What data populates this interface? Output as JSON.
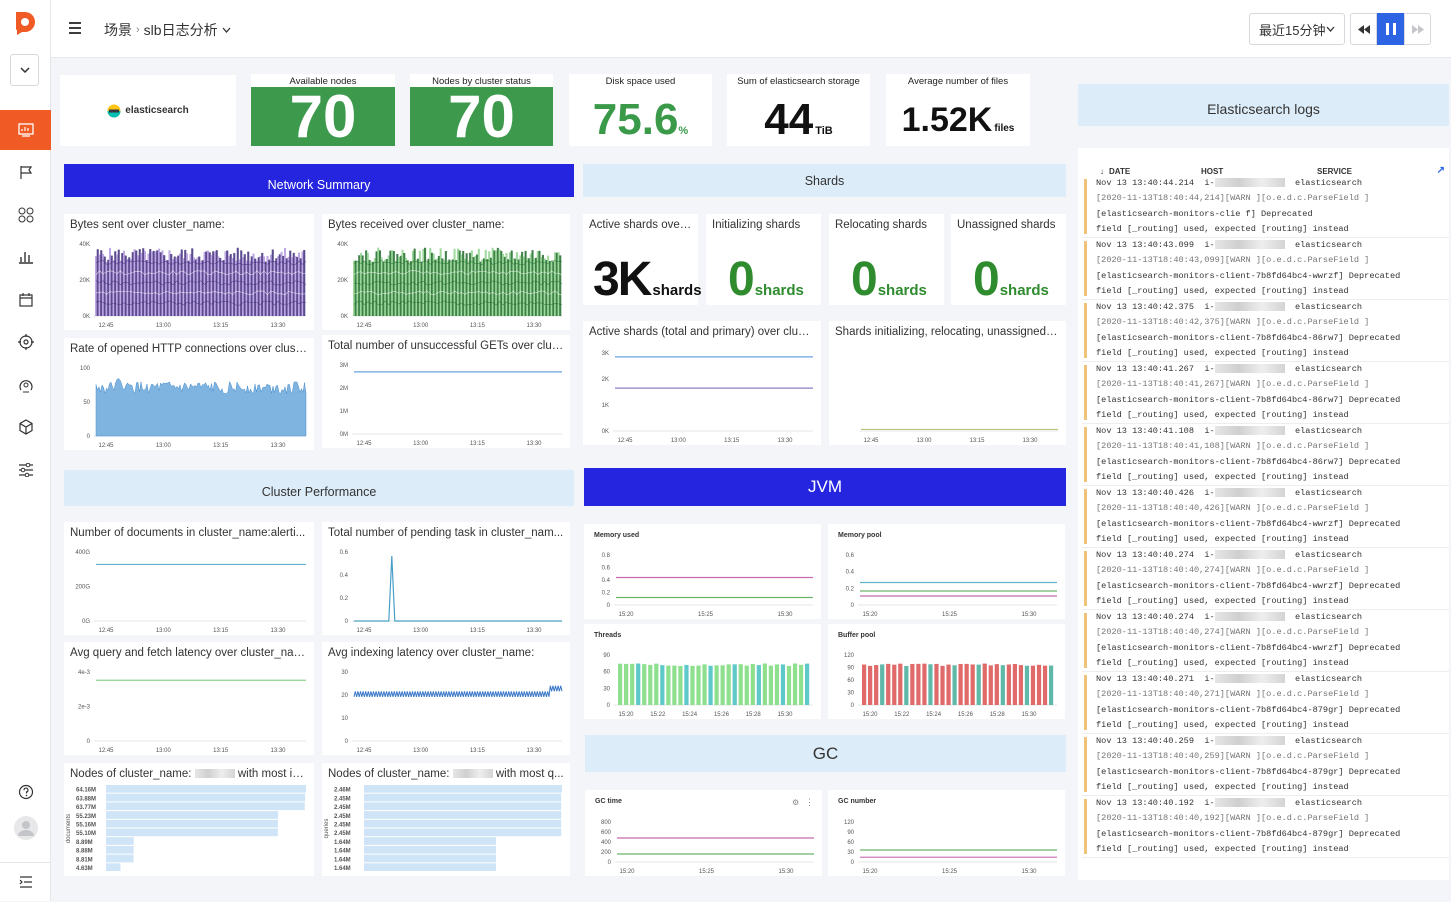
{
  "breadcrumb": {
    "root": "场景",
    "current": "slb日志分析"
  },
  "time_range": {
    "selected": "最近15分钟"
  },
  "stats": [
    {
      "label": "Available nodes",
      "value": "70"
    },
    {
      "label": "Nodes by cluster status",
      "value": "70"
    },
    {
      "label": "Disk space used",
      "value": "75.6",
      "unit": "%"
    },
    {
      "label": "Sum of elasticsearch storage",
      "value": "44",
      "unit": "TiB"
    },
    {
      "label": "Average number of files",
      "value": "1.52K",
      "unit": "files"
    }
  ],
  "logo_text": "elasticsearch",
  "sections": {
    "network": "Network Summary",
    "shards": "Shards",
    "cluster": "Cluster Performance",
    "jvm": "JVM",
    "gc": "GC",
    "logs": "Elasticsearch logs"
  },
  "panels": {
    "bytes_sent": "Bytes sent over cluster_name:",
    "bytes_received": "Bytes received over cluster_name:",
    "http_rate": "Rate of opened HTTP connections over cluste...",
    "unsucc_gets": "Total number of unsuccessful GETs over clust...",
    "docs": "Number of documents in cluster_name:alerti...",
    "pending": "Total number of pending task in cluster_nam...",
    "query_latency": "Avg query and fetch latency over cluster_nam...",
    "index_latency": "Avg indexing latency over cluster_name:",
    "nodes_docs": "Nodes of cluster_name:",
    "nodes_docs_suffix": "with most in...",
    "nodes_queries": "Nodes of cluster_name:",
    "nodes_queries_suffix": "with most q...",
    "active_shards_over": "Active shards (total and primary) over cluster...",
    "shards_init_reloc": "Shards initializing, relocating, unassigned ove..."
  },
  "shard_stats": [
    {
      "label": "Active shards over c...",
      "value": "3K",
      "unit": "shards"
    },
    {
      "label": "Initializing shards",
      "value": "0",
      "unit": "shards"
    },
    {
      "label": "Relocating shards",
      "value": "0",
      "unit": "shards"
    },
    {
      "label": "Unassigned shards",
      "value": "0",
      "unit": "shards"
    }
  ],
  "jvm_panels": {
    "memory_used": "Memory used",
    "memory_pool": "Memory pool",
    "threads": "Threads",
    "buffer_pool": "Buffer pool"
  },
  "gc_panels": {
    "gc_time": "GC time",
    "gc_number": "GC number"
  },
  "axes": {
    "time_main": [
      "12:45",
      "13:00",
      "13:15",
      "13:30"
    ],
    "time_jvm": [
      "15:20",
      "15:25",
      "15:30"
    ],
    "time_bars": [
      "15:20",
      "15:22",
      "15:24",
      "15:26",
      "15:28",
      "15:30"
    ],
    "bytes": [
      "40K",
      "20K",
      "0K"
    ],
    "http": [
      "100",
      "50",
      "0"
    ],
    "gets": [
      "3M",
      "2M",
      "1M",
      "0M"
    ],
    "docs": [
      "400G",
      "200G",
      "0G"
    ],
    "pending": [
      "0.6",
      "0.4",
      "0.2",
      "0"
    ],
    "query": [
      "4e-3",
      "2e-3",
      "0"
    ],
    "index": [
      "30",
      "20",
      "10",
      "0"
    ],
    "shards": [
      "3K",
      "2K",
      "1K",
      "0K"
    ],
    "mem_used": [
      "0.8",
      "0.6",
      "0.4",
      "0.2",
      "0"
    ],
    "mem_pool": [
      "0.6",
      "0.4",
      "0.2",
      "0"
    ],
    "threads": [
      "90",
      "60",
      "30",
      "0"
    ],
    "buffer": [
      "120",
      "90",
      "60",
      "30",
      "0"
    ],
    "gc_time": [
      "800",
      "600",
      "400",
      "200",
      "0"
    ],
    "gc_number": [
      "120",
      "90",
      "60",
      "30",
      "0"
    ]
  },
  "top_nodes_docs": {
    "axis_label": "documents",
    "values": [
      "64.16M",
      "63.88M",
      "63.77M",
      "55.23M",
      "55.16M",
      "55.10M",
      "8.89M",
      "8.88M",
      "8.81M",
      "4.63M"
    ]
  },
  "top_nodes_queries": {
    "axis_label": "queries",
    "values": [
      "2.46M",
      "2.45M",
      "2.45M",
      "2.45M",
      "2.45M",
      "2.45M",
      "1.64M",
      "1.64M",
      "1.64M",
      "1.64M"
    ]
  },
  "logs_header": {
    "date": "DATE",
    "host": "HOST",
    "service": "SERVICE"
  },
  "logs": [
    {
      "date": "Nov 13 13:40:44.214",
      "host": "i-",
      "service": "elasticsearch",
      "l1": "[2020-11-13T18:40:44,214][WARN ][o.e.d.c.ParseField       ]",
      "l2": "[elasticsearch-monitors-clie              f] Deprecated",
      "l3": "field [_routing] used, expected [routing] instead"
    },
    {
      "date": "Nov 13 13:40:43.099",
      "host": "i-",
      "service": "elasticsearch",
      "l1": "[2020-11-13T18:40:43,099][WARN ][o.e.d.c.ParseField       ]",
      "l2": "[elasticsearch-monitors-client-7b8fd64bc4-wwrzf] Deprecated",
      "l3": "field [_routing] used, expected [routing] instead"
    },
    {
      "date": "Nov 13 13:40:42.375",
      "host": "i-",
      "service": "elasticsearch",
      "l1": "[2020-11-13T18:40:42,375][WARN ][o.e.d.c.ParseField       ]",
      "l2": "[elasticsearch-monitors-client-7b8fd64bc4-86rw7] Deprecated",
      "l3": "field [_routing] used, expected [routing] instead"
    },
    {
      "date": "Nov 13 13:40:41.267",
      "host": "i-",
      "service": "elasticsearch",
      "l1": "[2020-11-13T18:40:41,267][WARN ][o.e.d.c.ParseField       ]",
      "l2": "[elasticsearch-monitors-client-7b8fd64bc4-86rw7] Deprecated",
      "l3": "field [_routing] used, expected [routing] instead"
    },
    {
      "date": "Nov 13 13:40:41.108",
      "host": "i-",
      "service": "elasticsearch",
      "l1": "[2020-11-13T18:40:41,108][WARN ][o.e.d.c.ParseField       ]",
      "l2": "[elasticsearch-monitors-client-7b8fd64bc4-86rw7] Deprecated",
      "l3": "field [_routing] used, expected [routing] instead"
    },
    {
      "date": "Nov 13 13:40:40.426",
      "host": "i-",
      "service": "elasticsearch",
      "l1": "[2020-11-13T18:40:40,426][WARN ][o.e.d.c.ParseField       ]",
      "l2": "[elasticsearch-monitors-client-7b8fd64bc4-wwrzf] Deprecated",
      "l3": "field [_routing] used, expected [routing] instead"
    },
    {
      "date": "Nov 13 13:40:40.274",
      "host": "i-",
      "service": "elasticsearch",
      "l1": "[2020-11-13T18:40:40,274][WARN ][o.e.d.c.ParseField       ]",
      "l2": "[elasticsearch-monitors-client-7b8fd64bc4-wwrzf] Deprecated",
      "l3": "field [_routing] used, expected [routing] instead"
    },
    {
      "date": "Nov 13 13:40:40.274",
      "host": "i-",
      "service": "elasticsearch",
      "l1": "[2020-11-13T18:40:40,274][WARN ][o.e.d.c.ParseField       ]",
      "l2": "[elasticsearch-monitors-client-7b8fd64bc4-wwrzf] Deprecated",
      "l3": "field [_routing] used, expected [routing] instead"
    },
    {
      "date": "Nov 13 13:40:40.271",
      "host": "i-",
      "service": "elasticsearch",
      "l1": "[2020-11-13T18:40:40,271][WARN ][o.e.d.c.ParseField       ]",
      "l2": "[elasticsearch-monitors-client-7b8fd64bc4-879gr] Deprecated",
      "l3": "field [_routing] used, expected [routing] instead"
    },
    {
      "date": "Nov 13 13:40:40.259",
      "host": "i-",
      "service": "elasticsearch",
      "l1": "[2020-11-13T18:40:40,259][WARN ][o.e.d.c.ParseField       ]",
      "l2": "[elasticsearch-monitors-client-7b8fd64bc4-879gr] Deprecated",
      "l3": "field [_routing] used, expected [routing] instead"
    },
    {
      "date": "Nov 13 13:40:40.192",
      "host": "i-",
      "service": "elasticsearch",
      "l1": "[2020-11-13T18:40:40,192][WARN ][o.e.d.c.ParseField       ]",
      "l2": "[elasticsearch-monitors-client-7b8fd64bc4-879gr] Deprecated",
      "l3": "field [_routing] used, expected [routing] instead"
    }
  ],
  "colors": {
    "accent": "#f05a24",
    "blue_banner": "#2525e0",
    "light_banner": "#dcecf8",
    "green_stat": "#3d9a4d",
    "log_bar": "#f0c37a"
  }
}
